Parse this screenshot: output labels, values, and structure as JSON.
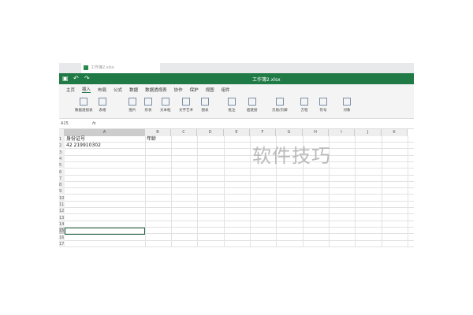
{
  "window": {
    "doc_tab": "工作簿2.xlsx",
    "title": "工作簿2.xlsx"
  },
  "menu": [
    "主页",
    "插入",
    "布局",
    "公式",
    "数据",
    "数据透视表",
    "协作",
    "保护",
    "视图",
    "组件"
  ],
  "toolbar": [
    "数据透视表",
    "表格",
    "图片",
    "形状",
    "文本框",
    "文字艺术",
    "图表",
    "批注",
    "超链接",
    "页眉/页脚",
    "方程",
    "符号",
    "对象"
  ],
  "formula_bar": {
    "cell_ref": "A15",
    "fx": "fx"
  },
  "columns": [
    "A",
    "B",
    "C",
    "D",
    "E",
    "F",
    "G",
    "H",
    "I",
    "J",
    "K"
  ],
  "rows": [
    "1",
    "2",
    "3",
    "4",
    "5",
    "6",
    "7",
    "8",
    "9",
    "10",
    "11",
    "12",
    "13",
    "14",
    "15",
    "16",
    "17"
  ],
  "cells": {
    "A1": "身份证号",
    "B1": "年龄",
    "A2": "42     219910302"
  },
  "watermark": "软件技巧"
}
